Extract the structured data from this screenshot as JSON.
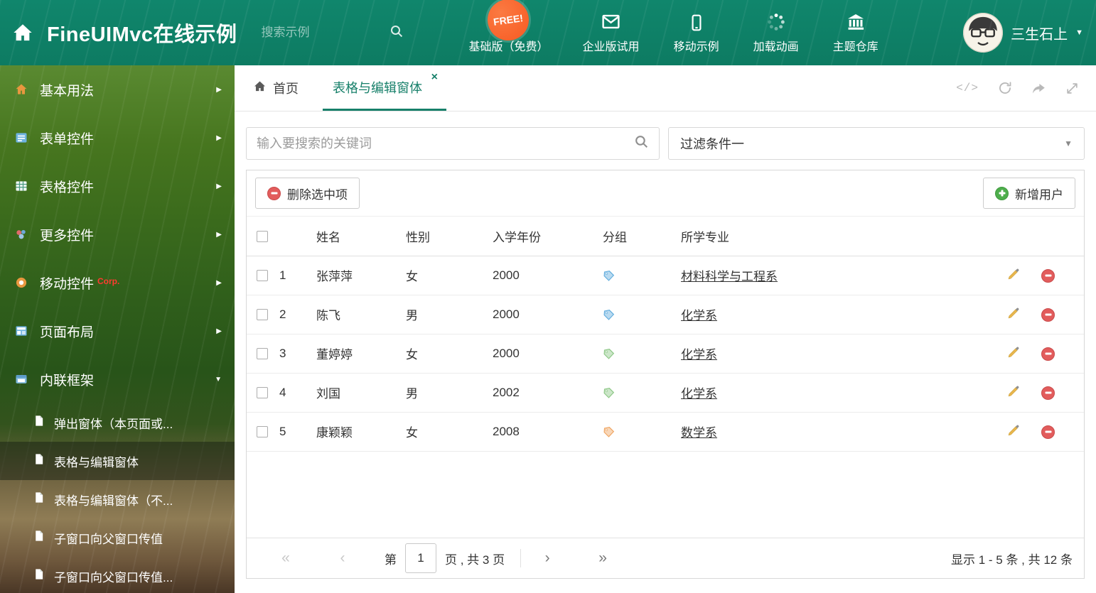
{
  "theme": {
    "header_bg": "#0d7b62",
    "accent": "#17806a",
    "free_badge_bg": "#f75a22",
    "delete_red": "#e25c5c",
    "add_green": "#4eae4c",
    "link_color": "#333333",
    "corp_red": "#ff3b30"
  },
  "header": {
    "title": "FineUIMvc在线示例",
    "search_placeholder": "搜索示例",
    "free_badge": "FREE!",
    "nav": [
      {
        "label": "基础版（免费）",
        "icon": "download-icon"
      },
      {
        "label": "企业版试用",
        "icon": "envelope-icon"
      },
      {
        "label": "移动示例",
        "icon": "mobile-icon"
      },
      {
        "label": "加载动画",
        "icon": "spinner-icon"
      },
      {
        "label": "主题仓库",
        "icon": "bank-icon"
      }
    ],
    "user_name": "三生石上"
  },
  "sidebar": {
    "items": [
      {
        "label": "基本用法"
      },
      {
        "label": "表单控件"
      },
      {
        "label": "表格控件"
      },
      {
        "label": "更多控件"
      },
      {
        "label": "移动控件",
        "badge": "Corp."
      },
      {
        "label": "页面布局"
      },
      {
        "label": "内联框架"
      }
    ],
    "subitems": [
      {
        "label": "弹出窗体（本页面或..."
      },
      {
        "label": "表格与编辑窗体"
      },
      {
        "label": "表格与编辑窗体（不..."
      },
      {
        "label": "子窗口向父窗口传值"
      },
      {
        "label": "子窗口向父窗口传值..."
      }
    ]
  },
  "tabs": {
    "home_label": "首页",
    "active_label": "表格与编辑窗体"
  },
  "filter": {
    "search_placeholder": "输入要搜索的关键词",
    "dropdown_value": "过滤条件一"
  },
  "toolbar": {
    "delete_label": "删除选中项",
    "add_label": "新增用户"
  },
  "table": {
    "headers": [
      "姓名",
      "性别",
      "入学年份",
      "分组",
      "所学专业"
    ],
    "rows": [
      {
        "num": "1",
        "name": "张萍萍",
        "gender": "女",
        "year": "2000",
        "tag_color": "#64aede",
        "major": "材料科学与工程系"
      },
      {
        "num": "2",
        "name": "陈飞",
        "gender": "男",
        "year": "2000",
        "tag_color": "#64aede",
        "major": "化学系"
      },
      {
        "num": "3",
        "name": "董婷婷",
        "gender": "女",
        "year": "2000",
        "tag_color": "#8ec887",
        "major": "化学系"
      },
      {
        "num": "4",
        "name": "刘国",
        "gender": "男",
        "year": "2002",
        "tag_color": "#8ec887",
        "major": "化学系"
      },
      {
        "num": "5",
        "name": "康颖颖",
        "gender": "女",
        "year": "2008",
        "tag_color": "#f0a663",
        "major": "数学系"
      }
    ]
  },
  "pagination": {
    "label_page": "第",
    "current_page": "1",
    "label_total": "页 , 共 3 页",
    "summary": "显示 1 - 5 条 , 共 12 条"
  },
  "icons": {
    "arrow_right": "▶",
    "arrow_down": "▼",
    "caret_down": "▼",
    "close": "×",
    "code": "</>",
    "pager_first": "«",
    "pager_prev": "‹",
    "pager_next": "›",
    "pager_last": "»"
  }
}
